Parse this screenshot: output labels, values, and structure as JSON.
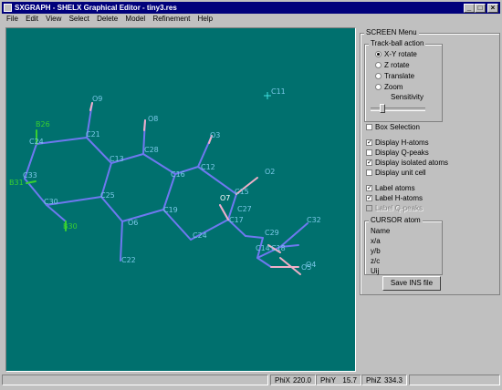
{
  "window": {
    "title": "SXGRAPH - SHELX Graphical Editor - tiny3.res",
    "controls": [
      "_",
      "□",
      "×"
    ]
  },
  "menu": [
    "File",
    "Edit",
    "View",
    "Select",
    "Delete",
    "Model",
    "Refinement",
    "Help"
  ],
  "screen_menu": {
    "title": "SCREEN Menu",
    "trackball": {
      "title": "Track-ball action",
      "options": [
        "X-Y rotate",
        "Z rotate",
        "Translate",
        "Zoom"
      ],
      "selected": "X-Y rotate",
      "sensitivity_label": "Sensitivity"
    },
    "options": [
      {
        "label": "Box Selection",
        "checked": false,
        "enabled": true
      },
      {
        "label": "Display H-atoms",
        "checked": true,
        "enabled": true
      },
      {
        "label": "Display Q-peaks",
        "checked": false,
        "enabled": true
      },
      {
        "label": "Display isolated atoms",
        "checked": true,
        "enabled": true
      },
      {
        "label": "Display unit cell",
        "checked": false,
        "enabled": true
      },
      {
        "label": "Label atoms",
        "checked": true,
        "enabled": true
      },
      {
        "label": "Label H-atoms",
        "checked": true,
        "enabled": true
      },
      {
        "label": "Label Q-peaks",
        "checked": false,
        "enabled": false
      }
    ],
    "cursor_atom": {
      "title": "CURSOR atom",
      "fields": [
        "Name",
        "x/a",
        "y/b",
        "z/c",
        "Uij"
      ]
    },
    "save_button": "Save INS file"
  },
  "status": {
    "phi_x_label": "PhiX",
    "phi_x": "220.0",
    "phi_y_label": "PhiY",
    "phi_y": "15.7",
    "phi_z_label": "PhiZ",
    "phi_z": "334.3"
  },
  "colors": {
    "background": "#00706e",
    "bond": "#6e78f0",
    "oxygen_bond": "#f0b0c8",
    "bromine_bond": "#38d030",
    "label": "#7ac8e8",
    "isolated_atom": "#40e0e0"
  },
  "molecule": {
    "labels": [
      "C11",
      "O9",
      "O8",
      "O3",
      "B26",
      "C24",
      "C21",
      "C28",
      "C12",
      "C13",
      "C16",
      "O2",
      "C33",
      "C25",
      "B31",
      "C30",
      "C19",
      "C15",
      "O7",
      "C27",
      "C17",
      "B30",
      "O6",
      "C24",
      "C32",
      "C29",
      "C14",
      "C18",
      "O5",
      "O4",
      "C22"
    ]
  }
}
